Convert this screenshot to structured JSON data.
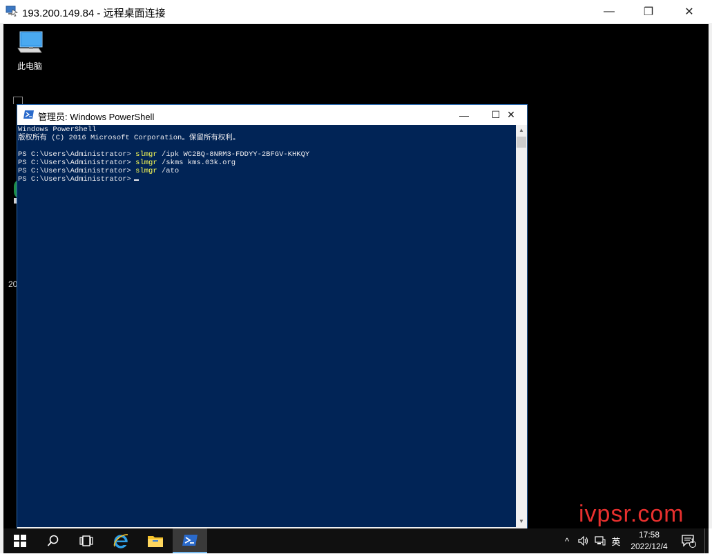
{
  "rdp_window": {
    "title": "193.200.149.84 - 远程桌面连接",
    "minimize_glyph": "—",
    "maximize_glyph": "❐",
    "close_glyph": "✕"
  },
  "desktop": {
    "this_pc_label": "此电脑",
    "partial_text_1": "20"
  },
  "powershell": {
    "title": "管理员: Windows PowerShell",
    "minimize_glyph": "—",
    "maximize_glyph": "☐",
    "close_glyph": "✕",
    "console": {
      "header_line_1": "Windows PowerShell",
      "header_line_2": "版权所有 (C) 2016 Microsoft Corporation。保留所有权利。",
      "lines": [
        {
          "prompt": "PS C:\\Users\\Administrator> ",
          "cmd": "slmgr",
          "args": " /ipk WC2BQ-8NRM3-FDDYY-2BFGV-KHKQY"
        },
        {
          "prompt": "PS C:\\Users\\Administrator> ",
          "cmd": "slmgr",
          "args": " /skms kms.03k.org"
        },
        {
          "prompt": "PS C:\\Users\\Administrator> ",
          "cmd": "slmgr",
          "args": " /ato"
        },
        {
          "prompt": "PS C:\\Users\\Administrator>",
          "cmd": "",
          "args": ""
        }
      ]
    }
  },
  "taskbar": {
    "items": [
      "start-button",
      "search-button",
      "task-view-button",
      "internet-explorer",
      "file-explorer",
      "powershell"
    ],
    "tray": {
      "chevron": "^",
      "ime_label": "英",
      "time": "17:58",
      "date": "2022/12/4",
      "notification_count": "1"
    }
  },
  "watermark": "ivpsr.com",
  "colors": {
    "console_bg": "#012456",
    "console_text": "#eeedf0",
    "command_yellow": "#ffff55",
    "taskbar_bg": "#101010",
    "watermark_red": "#e8302e"
  }
}
